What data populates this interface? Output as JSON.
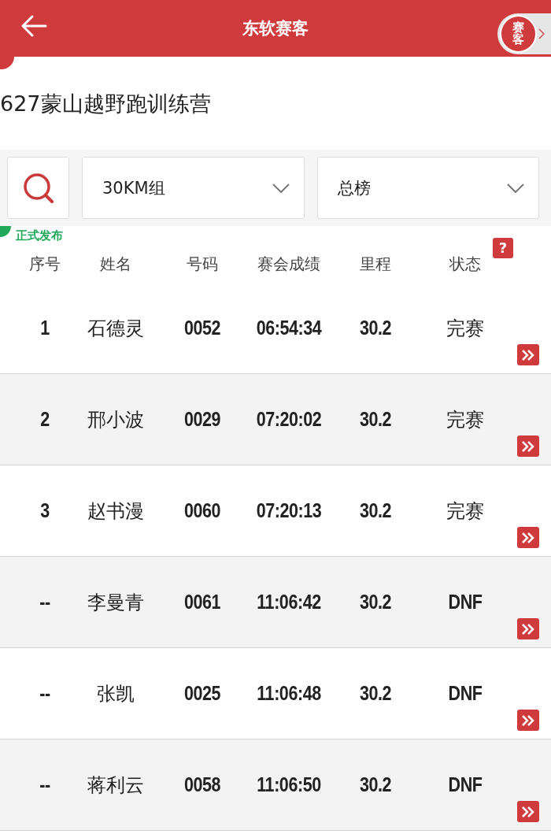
{
  "header": {
    "title": "东软赛客",
    "logo_text": "赛客"
  },
  "event_title": "627蒙山越野跑训练营",
  "filters": [
    {
      "value": "30KM组"
    },
    {
      "value": "总榜"
    }
  ],
  "publish_badge": "正式发布",
  "columns": [
    "序号",
    "姓名",
    "号码",
    "赛会成绩",
    "里程",
    "状态"
  ],
  "help_mark": "?",
  "rows": [
    {
      "rank": "1",
      "name": "石德灵",
      "bib": "0052",
      "time": "06:54:34",
      "distance": "30.2",
      "status": "完赛"
    },
    {
      "rank": "2",
      "name": "邢小波",
      "bib": "0029",
      "time": "07:20:02",
      "distance": "30.2",
      "status": "完赛"
    },
    {
      "rank": "3",
      "name": "赵书漫",
      "bib": "0060",
      "time": "07:20:13",
      "distance": "30.2",
      "status": "完赛"
    },
    {
      "rank": "--",
      "name": "李曼青",
      "bib": "0061",
      "time": "11:06:42",
      "distance": "30.2",
      "status": "DNF"
    },
    {
      "rank": "--",
      "name": "张凯",
      "bib": "0025",
      "time": "11:06:48",
      "distance": "30.2",
      "status": "DNF"
    },
    {
      "rank": "--",
      "name": "蒋利云",
      "bib": "0058",
      "time": "11:06:50",
      "distance": "30.2",
      "status": "DNF"
    }
  ]
}
